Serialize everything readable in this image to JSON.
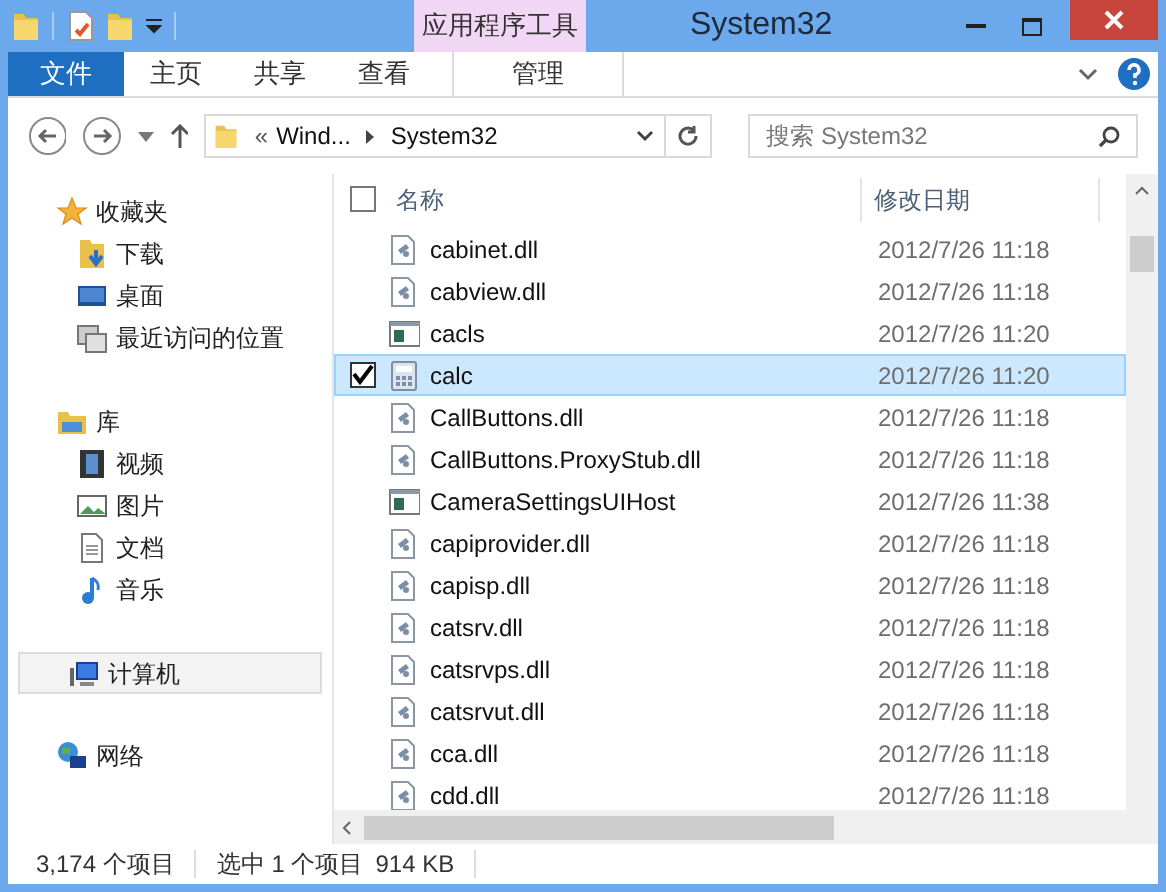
{
  "window": {
    "title": "System32",
    "context_tab": "应用程序工具"
  },
  "ribbon_tabs": [
    {
      "label": "文件",
      "selected": true,
      "kind": "file"
    },
    {
      "label": "主页",
      "selected": false,
      "kind": "normal"
    },
    {
      "label": "共享",
      "selected": false,
      "kind": "normal"
    },
    {
      "label": "查看",
      "selected": false,
      "kind": "normal"
    },
    {
      "label": "管理",
      "selected": false,
      "kind": "context"
    }
  ],
  "address": {
    "prefix": "«",
    "segments": [
      "Wind...",
      "System32"
    ]
  },
  "search": {
    "placeholder": "搜索 System32"
  },
  "sidebar": {
    "items": [
      {
        "label": "收藏夹",
        "kind": "star",
        "selected": false,
        "children": [
          {
            "label": "下载",
            "kind": "download",
            "selected": false
          },
          {
            "label": "桌面",
            "kind": "desktop",
            "selected": false
          },
          {
            "label": "最近访问的位置",
            "kind": "recent",
            "selected": false
          }
        ]
      },
      {
        "label": "库",
        "kind": "library",
        "selected": false,
        "children": [
          {
            "label": "视频",
            "kind": "video",
            "selected": false
          },
          {
            "label": "图片",
            "kind": "image",
            "selected": false
          },
          {
            "label": "文档",
            "kind": "doc",
            "selected": false
          },
          {
            "label": "音乐",
            "kind": "music",
            "selected": false
          }
        ]
      },
      {
        "label": "计算机",
        "kind": "computer",
        "selected": true
      },
      {
        "label": "网络",
        "kind": "network",
        "selected": false
      }
    ]
  },
  "table": {
    "columns": [
      "名称",
      "修改日期"
    ],
    "header_checked": false,
    "rows": [
      {
        "name": "cabinet.dll",
        "date": "2012/7/26 11:18",
        "kind": "dll",
        "selected": false
      },
      {
        "name": "cabview.dll",
        "date": "2012/7/26 11:18",
        "kind": "dll",
        "selected": false
      },
      {
        "name": "cacls",
        "date": "2012/7/26 11:20",
        "kind": "exe",
        "selected": false
      },
      {
        "name": "calc",
        "date": "2012/7/26 11:20",
        "kind": "calc",
        "selected": true
      },
      {
        "name": "CallButtons.dll",
        "date": "2012/7/26 11:18",
        "kind": "dll",
        "selected": false
      },
      {
        "name": "CallButtons.ProxyStub.dll",
        "date": "2012/7/26 11:18",
        "kind": "dll",
        "selected": false
      },
      {
        "name": "CameraSettingsUIHost",
        "date": "2012/7/26 11:38",
        "kind": "exe",
        "selected": false
      },
      {
        "name": "capiprovider.dll",
        "date": "2012/7/26 11:18",
        "kind": "dll",
        "selected": false
      },
      {
        "name": "capisp.dll",
        "date": "2012/7/26 11:18",
        "kind": "dll",
        "selected": false
      },
      {
        "name": "catsrv.dll",
        "date": "2012/7/26 11:18",
        "kind": "dll",
        "selected": false
      },
      {
        "name": "catsrvps.dll",
        "date": "2012/7/26 11:18",
        "kind": "dll",
        "selected": false
      },
      {
        "name": "catsrvut.dll",
        "date": "2012/7/26 11:18",
        "kind": "dll",
        "selected": false
      },
      {
        "name": "cca.dll",
        "date": "2012/7/26 11:18",
        "kind": "dll",
        "selected": false
      },
      {
        "name": "cdd.dll",
        "date": "2012/7/26 11:18",
        "kind": "dll",
        "selected": false
      }
    ]
  },
  "status_bar": {
    "count": "3,174 个项目",
    "selection": "选中 1 个项目",
    "size": "914 KB"
  }
}
